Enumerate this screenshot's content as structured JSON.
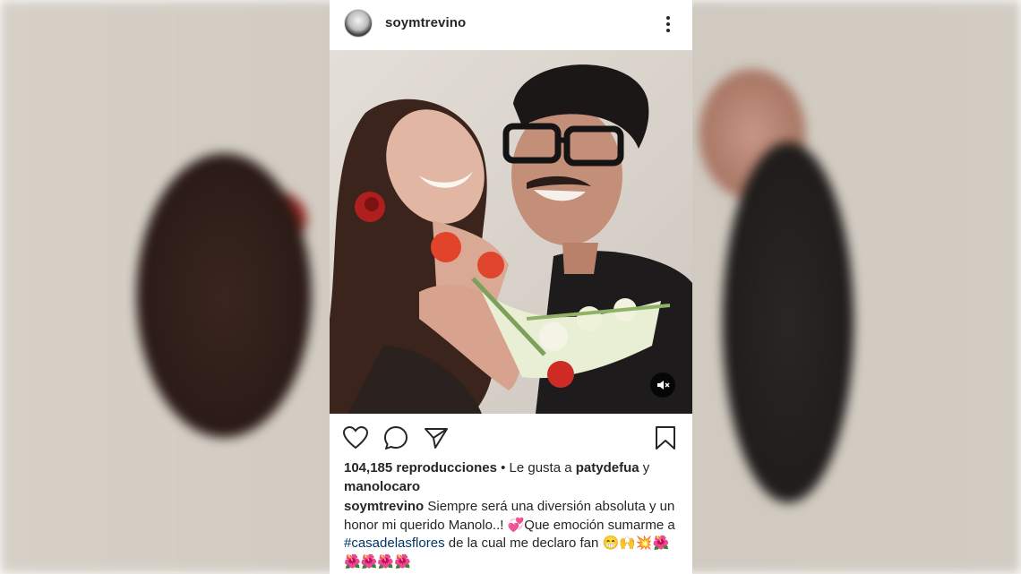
{
  "post": {
    "username": "soymtrevino",
    "more_icon": "more-vertical-icon",
    "mute_icon": "volume-muted-icon"
  },
  "actions": {
    "like_icon": "heart-icon",
    "comment_icon": "comment-icon",
    "share_icon": "send-icon",
    "save_icon": "bookmark-icon"
  },
  "stats": {
    "views": "104,185 reproducciones",
    "liked_prefix": " • Le gusta a ",
    "liked_user_1": "patydefua",
    "liked_join": " y",
    "liked_user_2": "manolocaro"
  },
  "caption": {
    "author": "soymtrevino",
    "text_1": " Siempre será una diversión absoluta y un honor mi querido Manolo..! 💞Que emoción sumarme a ",
    "hashtag": "#casadelasflores",
    "text_2": " de la cual me declaro fan 😁🙌💥🌺🌺🌺🌺🌺"
  },
  "colors": {
    "background_blur": "#cfc9bf",
    "card": "#ffffff",
    "text": "#262626",
    "hashtag": "#003569"
  }
}
